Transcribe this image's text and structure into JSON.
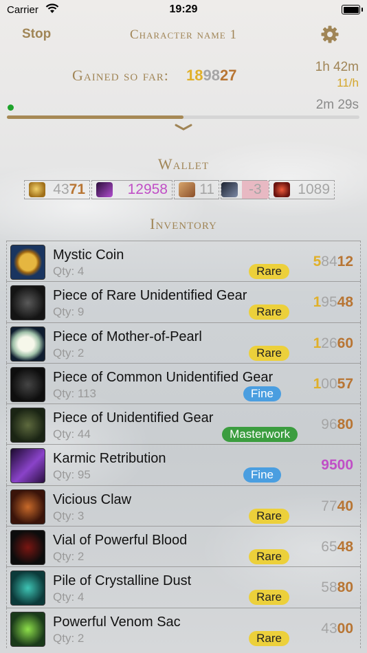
{
  "status_bar": {
    "carrier": "Carrier",
    "time": "19:29"
  },
  "header": {
    "stop_label": "Stop",
    "title": "Character name 1",
    "settings_icon": "gear-icon"
  },
  "gained": {
    "label": "Gained so far:",
    "gold": "18",
    "silver": "98",
    "copper": "27",
    "elapsed": "1h 42m",
    "rate": "11/h",
    "countdown": "2m 29s",
    "progress_fraction": 0.5
  },
  "wallet": {
    "title": "Wallet",
    "currencies": [
      {
        "icon": "coin-icon",
        "parts": [
          {
            "v": "43",
            "c": "silver"
          },
          {
            "v": "71",
            "c": "copper"
          }
        ]
      },
      {
        "icon": "karma-icon",
        "parts": [
          {
            "v": "12958",
            "c": "pink"
          }
        ]
      },
      {
        "icon": "laurel-icon",
        "parts": [
          {
            "v": "11",
            "c": "silver"
          }
        ]
      },
      {
        "icon": "spirit-shard-icon",
        "parts": [
          {
            "v": "-3",
            "c": "silver"
          }
        ],
        "highlight": "#e8b9c3"
      },
      {
        "icon": "gem-icon",
        "parts": [
          {
            "v": "1089",
            "c": "silver"
          }
        ]
      }
    ]
  },
  "inventory": {
    "title": "Inventory",
    "items": [
      {
        "name": "Mystic Coin",
        "qty": "Qty: 4",
        "rarity": "Rare",
        "price": [
          {
            "v": "5",
            "c": "gold"
          },
          {
            "v": "84",
            "c": "silver"
          },
          {
            "v": "12",
            "c": "copper"
          }
        ],
        "icon": "mystic-coin-icon"
      },
      {
        "name": "Piece of Rare Unidentified Gear",
        "qty": "Qty: 9",
        "rarity": "Rare",
        "price": [
          {
            "v": "1",
            "c": "gold"
          },
          {
            "v": "95",
            "c": "silver"
          },
          {
            "v": "48",
            "c": "copper"
          }
        ],
        "icon": "rare-gear-icon"
      },
      {
        "name": "Piece of Mother-of-Pearl",
        "qty": "Qty: 2",
        "rarity": "Rare",
        "price": [
          {
            "v": "1",
            "c": "gold"
          },
          {
            "v": "26",
            "c": "silver"
          },
          {
            "v": "60",
            "c": "copper"
          }
        ],
        "icon": "pearl-icon"
      },
      {
        "name": "Piece of Common Unidentified Gear",
        "qty": "Qty: 113",
        "rarity": "Fine",
        "price": [
          {
            "v": "1",
            "c": "gold"
          },
          {
            "v": "00",
            "c": "silver"
          },
          {
            "v": "57",
            "c": "copper"
          }
        ],
        "icon": "common-gear-icon"
      },
      {
        "name": "Piece of Unidentified Gear",
        "qty": "Qty: 44",
        "rarity": "Masterwork",
        "price": [
          {
            "v": "96",
            "c": "silver"
          },
          {
            "v": "80",
            "c": "copper"
          }
        ],
        "icon": "gear-bag-icon"
      },
      {
        "name": "Karmic Retribution",
        "qty": "Qty: 95",
        "rarity": "Fine",
        "price": [
          {
            "v": "9500",
            "c": "pink"
          }
        ],
        "icon": "karmic-icon"
      },
      {
        "name": "Vicious Claw",
        "qty": "Qty: 3",
        "rarity": "Rare",
        "price": [
          {
            "v": "77",
            "c": "silver"
          },
          {
            "v": "40",
            "c": "copper"
          }
        ],
        "icon": "claw-icon"
      },
      {
        "name": "Vial of Powerful Blood",
        "qty": "Qty: 2",
        "rarity": "Rare",
        "price": [
          {
            "v": "65",
            "c": "silver"
          },
          {
            "v": "48",
            "c": "copper"
          }
        ],
        "icon": "blood-vial-icon"
      },
      {
        "name": "Pile of Crystalline Dust",
        "qty": "Qty: 4",
        "rarity": "Rare",
        "price": [
          {
            "v": "58",
            "c": "silver"
          },
          {
            "v": "80",
            "c": "copper"
          }
        ],
        "icon": "dust-icon"
      },
      {
        "name": "Powerful Venom Sac",
        "qty": "Qty: 2",
        "rarity": "Rare",
        "price": [
          {
            "v": "43",
            "c": "silver"
          },
          {
            "v": "00",
            "c": "copper"
          }
        ],
        "icon": "venom-sac-icon"
      }
    ]
  },
  "colors": {
    "accent": "#a08556",
    "gold": "#e0b02a",
    "silver": "#a5a5a5",
    "copper": "#b87533",
    "karma": "#c04fc6"
  }
}
